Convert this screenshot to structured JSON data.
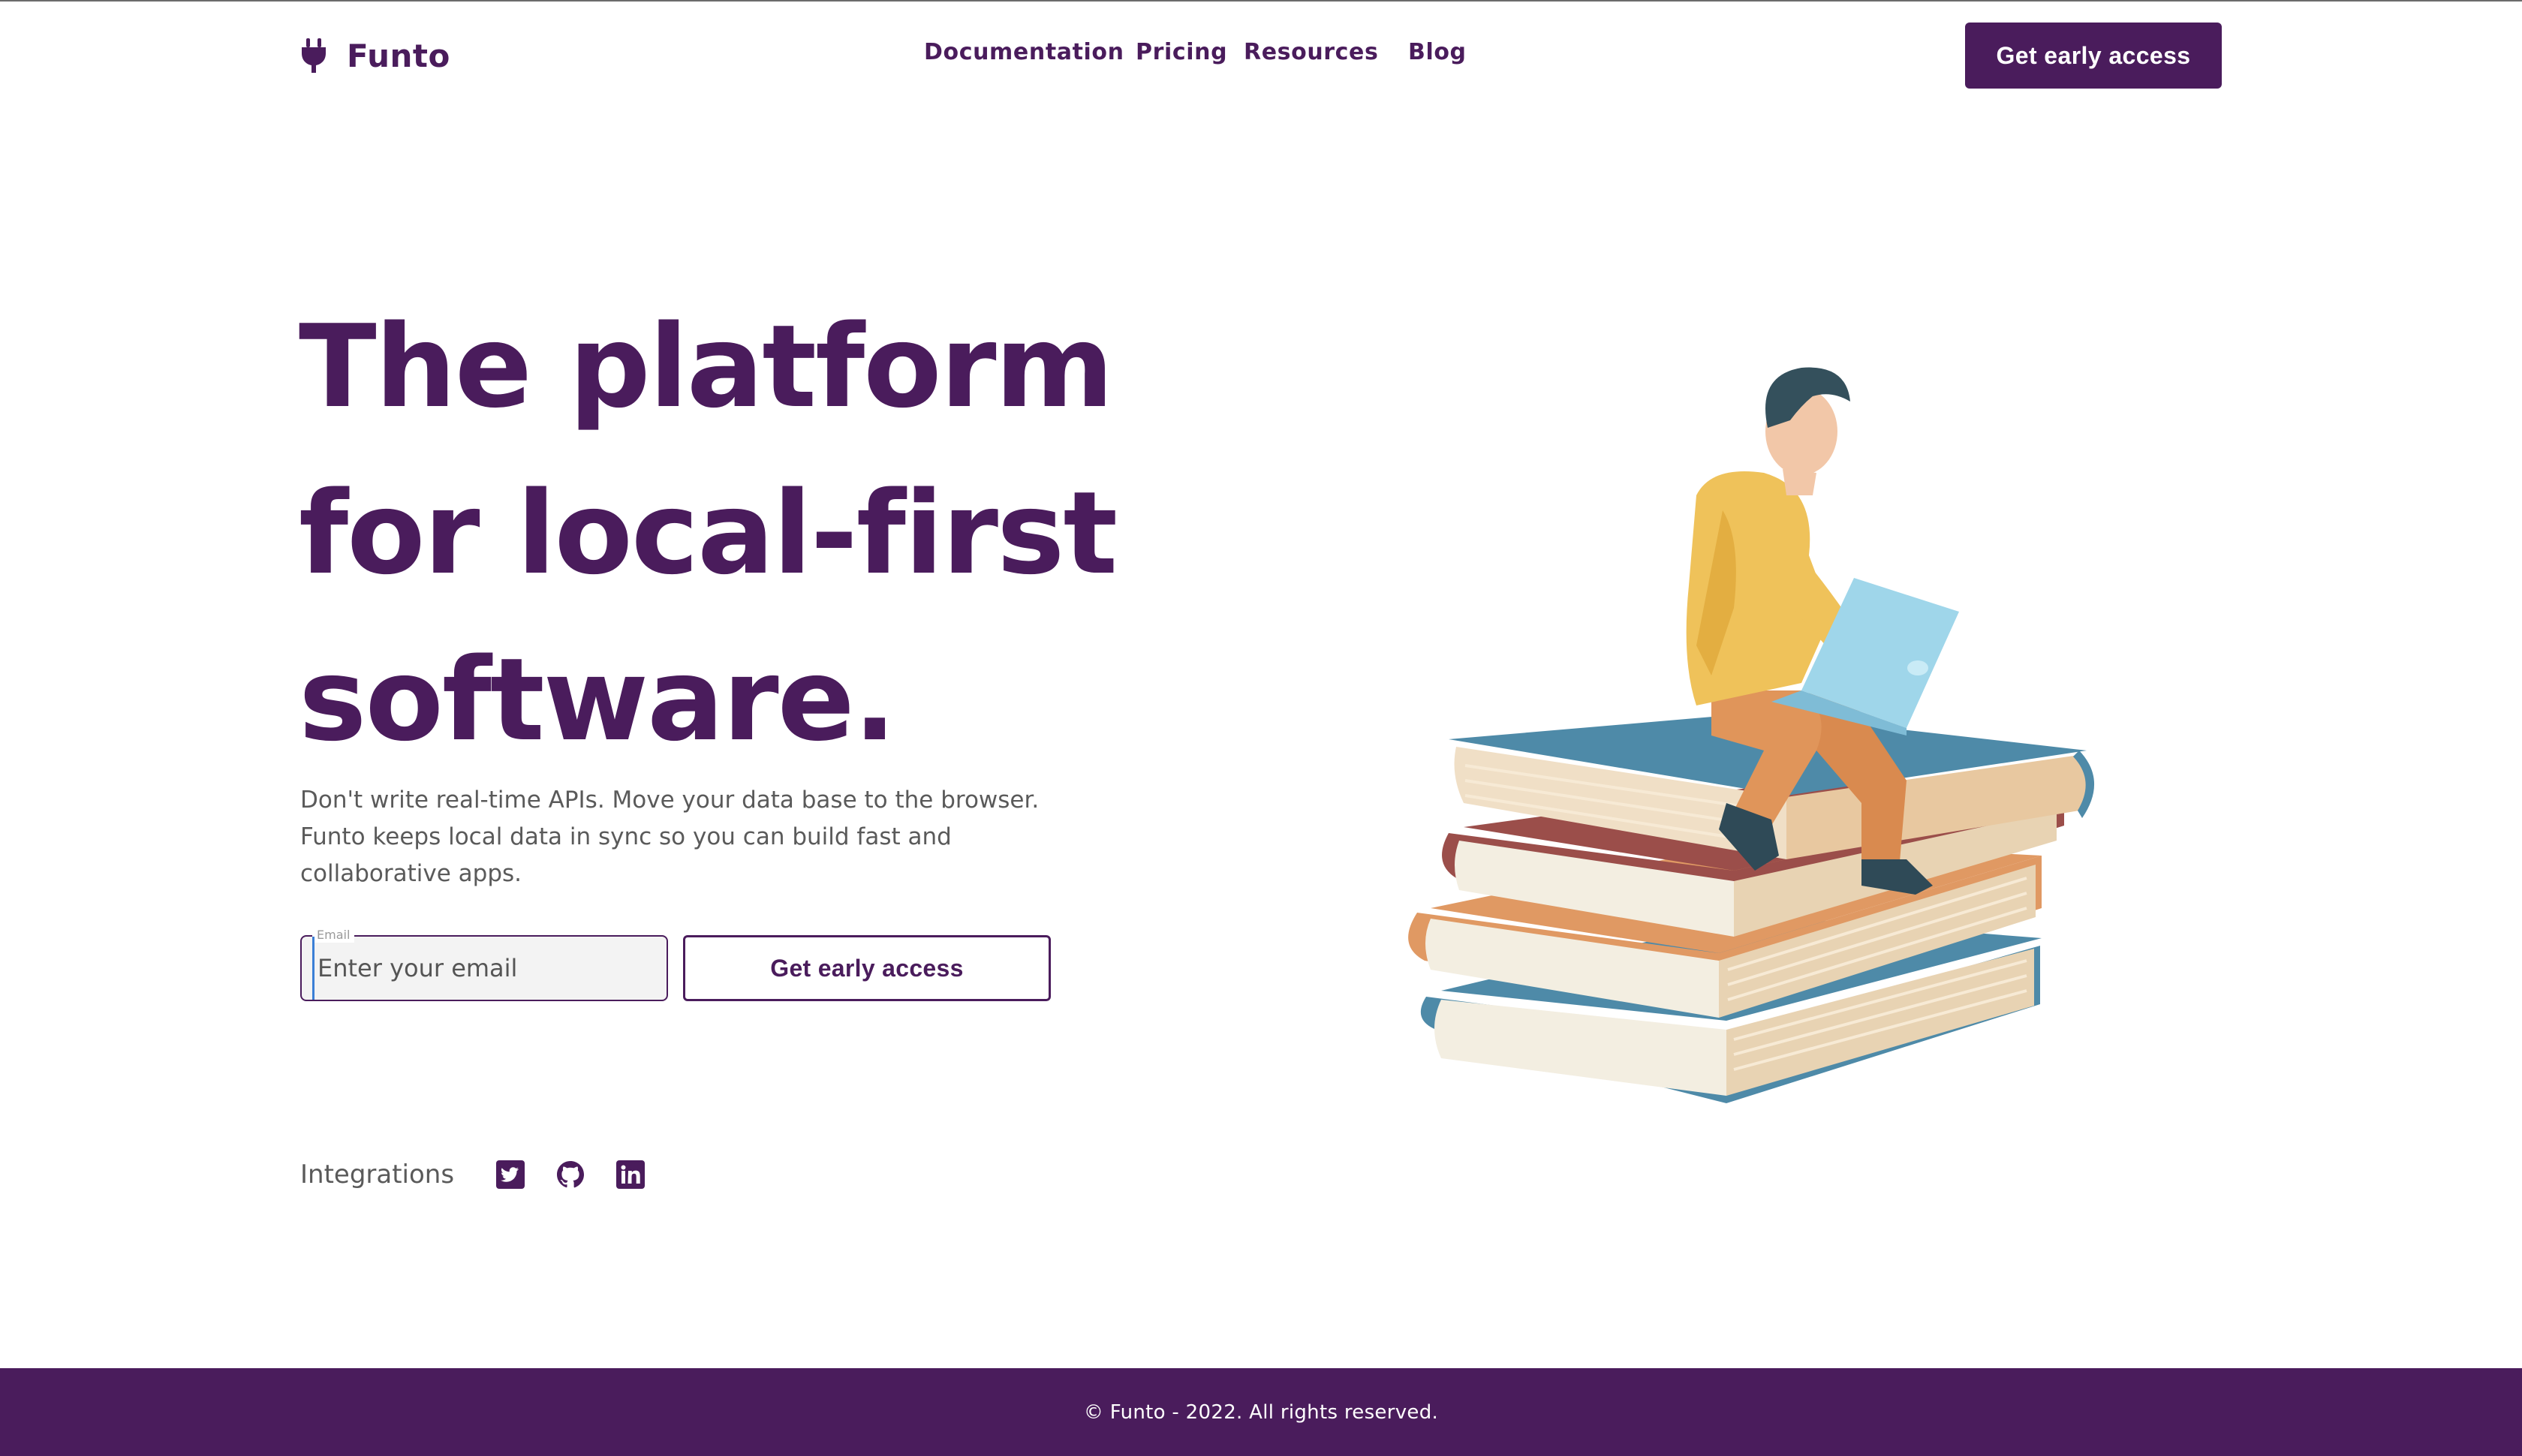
{
  "header": {
    "brand": "Funto",
    "nav": {
      "documentation": "Documentation",
      "pricing": "Pricing",
      "resources": "Resources",
      "blog": "Blog"
    },
    "cta_label": "Get early access"
  },
  "hero": {
    "title_lines": [
      "The platform",
      "for local-first",
      "software."
    ],
    "description_lines": [
      "Don't write real-time APIs. Move your data base to the browser.",
      "Funto keeps local data in sync so you can build fast and",
      "collaborative apps."
    ]
  },
  "signup": {
    "email_label": "Email",
    "email_placeholder": "Enter your email",
    "email_value": "",
    "cta_label": "Get early access"
  },
  "integrations": {
    "label": "Integrations",
    "icons": [
      "twitter-icon",
      "github-icon",
      "linkedin-icon"
    ]
  },
  "footer": {
    "text": "© Funto - 2022. All rights reserved."
  },
  "colors": {
    "brand": "#4a1c5c",
    "text_muted": "#5a5a5a",
    "background": "#ffffff"
  }
}
